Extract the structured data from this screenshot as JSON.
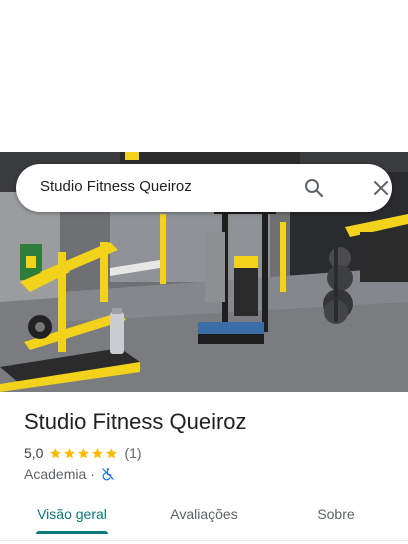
{
  "search": {
    "query": "Studio Fitness Queiroz"
  },
  "place": {
    "title": "Studio Fitness Queiroz",
    "rating": "5,0",
    "stars": 5,
    "review_count": "(1)",
    "category": "Academia",
    "separator": "·"
  },
  "tabs": [
    {
      "label": "Visão geral",
      "active": true
    },
    {
      "label": "Avaliações",
      "active": false
    },
    {
      "label": "Sobre",
      "active": false
    }
  ],
  "colors": {
    "accent": "#0b7a7a",
    "star": "#fbbc04",
    "machine_yellow": "#f2d21b",
    "accessibility_icon": "#1a73e8"
  },
  "icons": {
    "search": "search-icon",
    "close": "close-icon",
    "star": "star-icon",
    "accessibility": "no-wheelchair-access-icon"
  }
}
